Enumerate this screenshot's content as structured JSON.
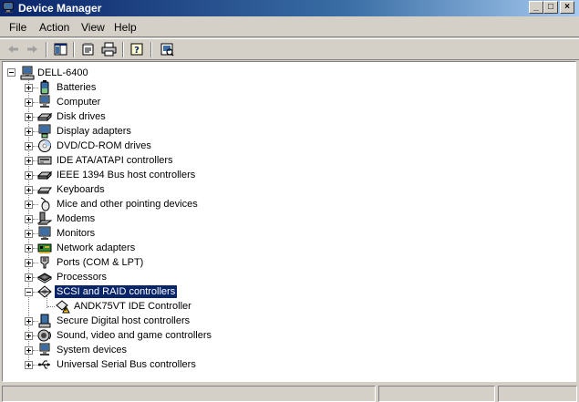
{
  "window": {
    "title": "Device Manager",
    "minimize_glyph": "_",
    "maximize_glyph": "□",
    "close_glyph": "×"
  },
  "menu": [
    "File",
    "Action",
    "View",
    "Help"
  ],
  "toolbar": {
    "buttons": [
      "back-icon",
      "forward-icon",
      "console-tree-icon",
      "properties-icon",
      "print-icon",
      "help-icon",
      "scan-hardware-icon"
    ]
  },
  "tree": {
    "root": "DELL-6400",
    "items": [
      {
        "label": "Batteries",
        "icon": "battery-icon",
        "expanded": false
      },
      {
        "label": "Computer",
        "icon": "computer-icon",
        "expanded": false
      },
      {
        "label": "Disk drives",
        "icon": "disk-drive-icon",
        "expanded": false
      },
      {
        "label": "Display adapters",
        "icon": "display-adapter-icon",
        "expanded": false
      },
      {
        "label": "DVD/CD-ROM drives",
        "icon": "cdrom-icon",
        "expanded": false
      },
      {
        "label": "IDE ATA/ATAPI controllers",
        "icon": "ide-controller-icon",
        "expanded": false
      },
      {
        "label": "IEEE 1394 Bus host controllers",
        "icon": "ieee1394-icon",
        "expanded": false
      },
      {
        "label": "Keyboards",
        "icon": "keyboard-icon",
        "expanded": false
      },
      {
        "label": "Mice and other pointing devices",
        "icon": "mouse-icon",
        "expanded": false
      },
      {
        "label": "Modems",
        "icon": "modem-icon",
        "expanded": false
      },
      {
        "label": "Monitors",
        "icon": "monitor-icon",
        "expanded": false
      },
      {
        "label": "Network adapters",
        "icon": "network-adapter-icon",
        "expanded": false
      },
      {
        "label": "Ports (COM & LPT)",
        "icon": "port-icon",
        "expanded": false
      },
      {
        "label": "Processors",
        "icon": "processor-icon",
        "expanded": false
      },
      {
        "label": "SCSI and RAID controllers",
        "icon": "scsi-controller-icon",
        "expanded": true,
        "selected": true,
        "children": [
          {
            "label": "ANDK75VT IDE Controller",
            "icon": "warning-device-icon"
          }
        ]
      },
      {
        "label": "Secure Digital host controllers",
        "icon": "sd-host-icon",
        "expanded": false
      },
      {
        "label": "Sound, video and game controllers",
        "icon": "sound-icon",
        "expanded": false
      },
      {
        "label": "System devices",
        "icon": "system-device-icon",
        "expanded": false
      },
      {
        "label": "Universal Serial Bus controllers",
        "icon": "usb-icon",
        "expanded": false
      }
    ]
  },
  "colors": {
    "titlebar": "#0a246a",
    "selection": "#0a246a",
    "chrome": "#d4d0c8",
    "warning": "#ffd400"
  }
}
